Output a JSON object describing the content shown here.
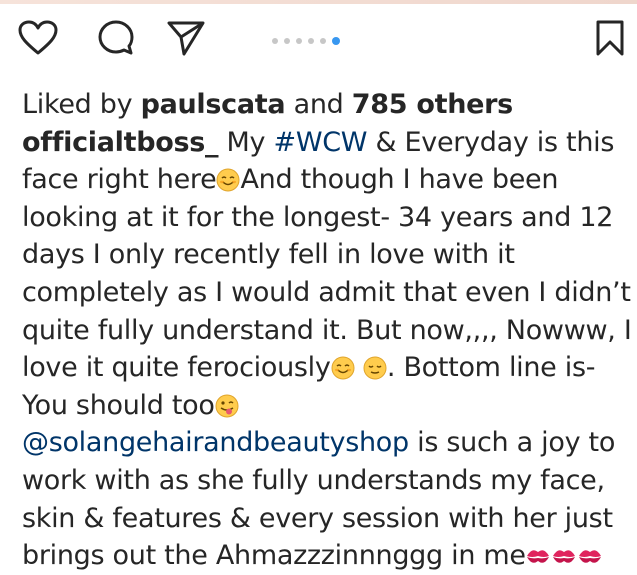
{
  "actions": {
    "like_icon": "heart-icon",
    "comment_icon": "comment-icon",
    "share_icon": "share-icon",
    "save_icon": "bookmark-icon",
    "carousel": {
      "count": 6,
      "active_index": 5
    }
  },
  "likes": {
    "prefix": "Liked by ",
    "user": "paulscata",
    "middle": " and ",
    "count": "785 others"
  },
  "caption": {
    "author": "officialtboss_",
    "part1": " My ",
    "hashtag": "#WCW",
    "part2": " & Everyday is this face right here",
    "part3": "And though I have been looking at it for the longest- 34 years and 12 days I only recently fell in love with it completely as I would admit that even I didn’t quite fully understand it. But now,,,, Nowww, I love it quite ferociously",
    "part4": ". Bottom line is- You should too",
    "mention": "@solangehairandbeautyshop",
    "part5": " is such a joy to work with as she fully understands my face, skin & features & every session with her just brings out the Ahmazzzinnnggg in me"
  },
  "colors": {
    "text": "#262626",
    "link": "#003569",
    "active_dot": "#3897f0",
    "inactive_dot": "#c7c7c7",
    "kiss": "#e0245e"
  }
}
